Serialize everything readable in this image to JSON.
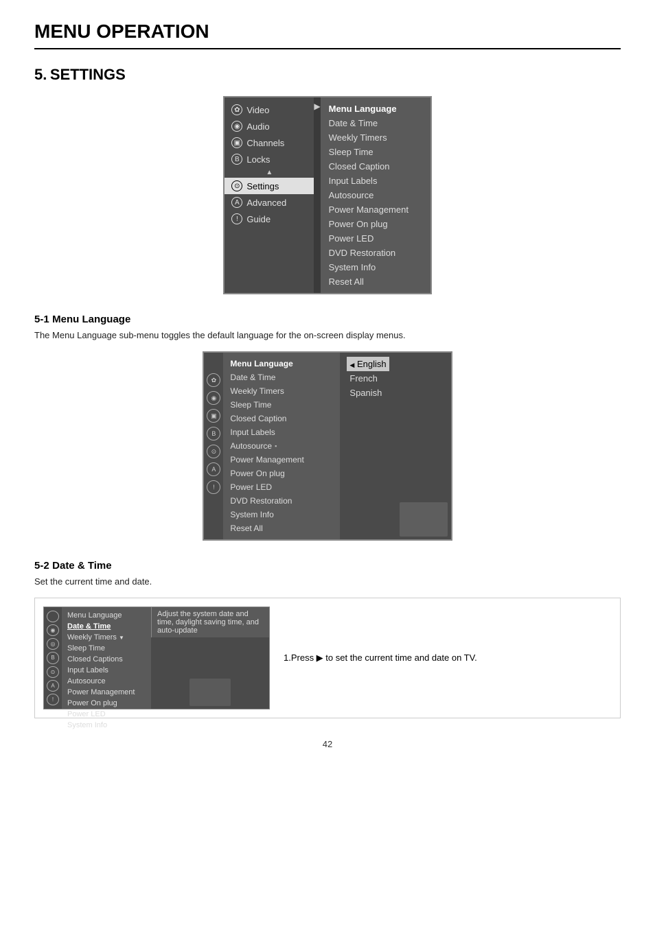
{
  "page": {
    "title": "MENU OPERATION",
    "page_number": "42"
  },
  "section": {
    "number": "5.",
    "title": "SETTINGS"
  },
  "menu1": {
    "left_items": [
      {
        "icon": "✿",
        "label": "Video",
        "selected": false
      },
      {
        "icon": "◉",
        "label": "Audio",
        "selected": false
      },
      {
        "icon": "▣",
        "label": "Channels",
        "selected": false
      },
      {
        "icon": "B",
        "label": "Locks",
        "selected": false
      },
      {
        "icon": "⊙",
        "label": "Settings",
        "selected": true
      },
      {
        "icon": "A",
        "label": "Advanced",
        "selected": false
      },
      {
        "icon": "!",
        "label": "Guide",
        "selected": false
      }
    ],
    "right_items": [
      {
        "label": "Menu Language",
        "selected": true
      },
      {
        "label": "Date & Time",
        "selected": false
      },
      {
        "label": "Weekly Timers",
        "selected": false
      },
      {
        "label": "Sleep Time",
        "selected": false
      },
      {
        "label": "Closed Caption",
        "selected": false
      },
      {
        "label": "Input Labels",
        "selected": false
      },
      {
        "label": "Autosource",
        "selected": false
      },
      {
        "label": "Power Management",
        "selected": false
      },
      {
        "label": "Power On plug",
        "selected": false
      },
      {
        "label": "Power LED",
        "selected": false
      },
      {
        "label": "DVD Restoration",
        "selected": false
      },
      {
        "label": "System Info",
        "selected": false
      },
      {
        "label": "Reset All",
        "selected": false
      }
    ]
  },
  "subsection1": {
    "number": "5-1",
    "title": "Menu Language",
    "description": "The Menu Language sub-menu toggles the default language for the on-screen display menus."
  },
  "menu2": {
    "center_items": [
      {
        "label": "Menu Language",
        "selected": true
      },
      {
        "label": "Date & Time",
        "selected": false
      },
      {
        "label": "Weekly Timers",
        "selected": false
      },
      {
        "label": "Sleep Time",
        "selected": false
      },
      {
        "label": "Closed Caption",
        "selected": false
      },
      {
        "label": "Input Labels",
        "selected": false
      },
      {
        "label": "Autosource",
        "selected": false
      },
      {
        "label": "Power Management",
        "selected": false
      },
      {
        "label": "Power On plug",
        "selected": false
      },
      {
        "label": "Power LED",
        "selected": false
      },
      {
        "label": "DVD Restoration",
        "selected": false
      },
      {
        "label": "System Info",
        "selected": false
      },
      {
        "label": "Reset All",
        "selected": false
      }
    ],
    "language_options": [
      {
        "label": "English",
        "selected": true
      },
      {
        "label": "French",
        "selected": false
      },
      {
        "label": "Spanish",
        "selected": false
      }
    ]
  },
  "subsection2": {
    "number": "5-2",
    "title": "Date & Time",
    "description": "Set the current time and date."
  },
  "datetime_menu": {
    "items": [
      {
        "label": "Menu Language",
        "selected": false,
        "underline": false
      },
      {
        "label": "Date & Time",
        "selected": true,
        "underline": true
      },
      {
        "label": "Weekly Timers",
        "selected": false,
        "underline": false
      },
      {
        "label": "Sleep Time",
        "selected": false,
        "underline": false
      },
      {
        "label": "Closed Captions",
        "selected": false,
        "underline": false
      },
      {
        "label": "Input Labels",
        "selected": false,
        "underline": false
      },
      {
        "label": "Autosource",
        "selected": false,
        "underline": false
      },
      {
        "label": "Power Management",
        "selected": false,
        "underline": false
      },
      {
        "label": "Power On plug",
        "selected": false,
        "underline": false
      },
      {
        "label": "Power LED",
        "selected": false,
        "underline": false
      },
      {
        "label": "System Info",
        "selected": false,
        "underline": false
      }
    ],
    "tooltip": "Adjust the system date and time, daylight saving time, and auto-update",
    "instruction": "1.Press ▶ to set the current time and date on TV."
  }
}
